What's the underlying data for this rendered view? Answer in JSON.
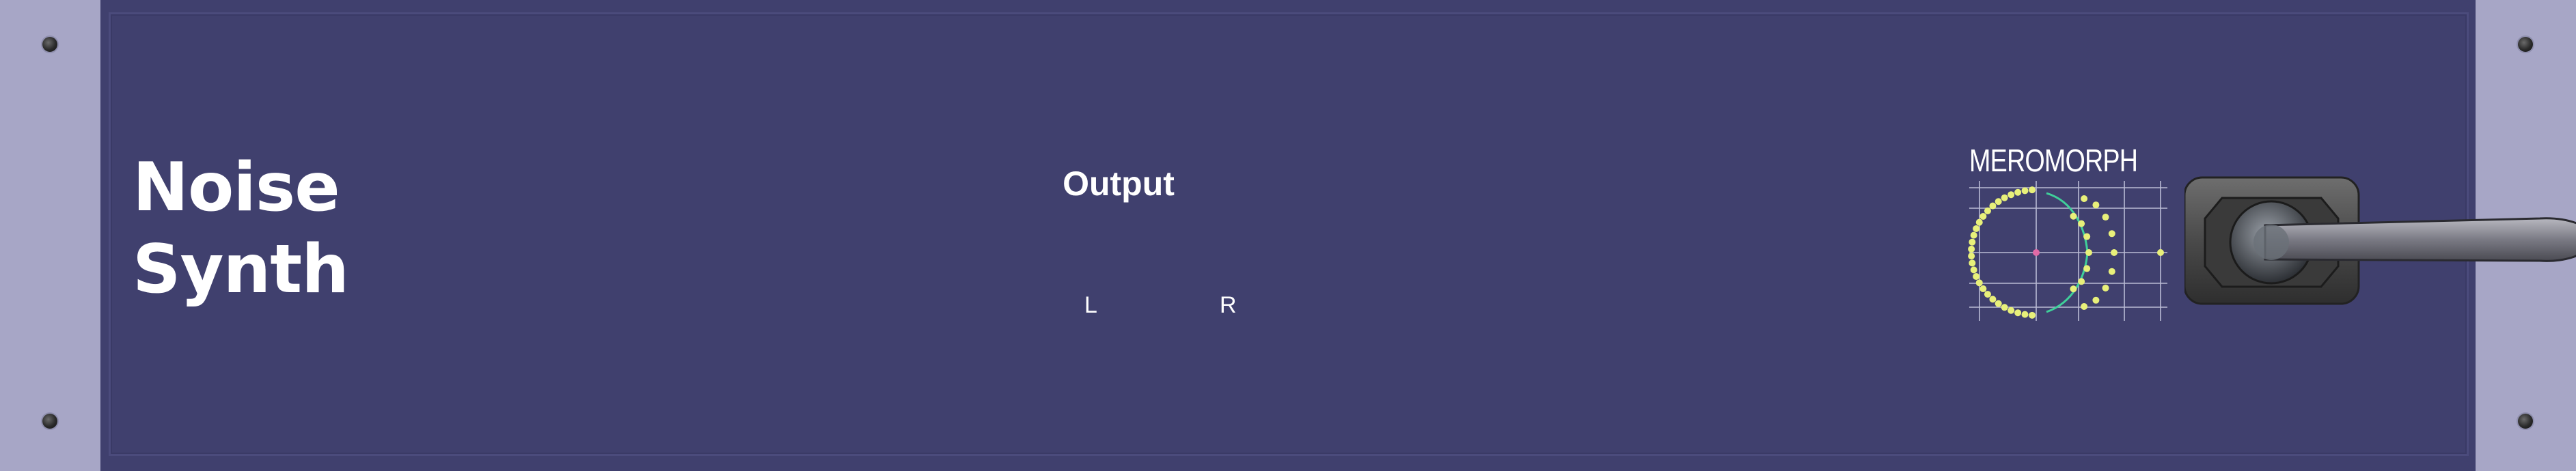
{
  "module": {
    "title_line1": "Noise",
    "title_line2": "Synth",
    "output_label": "Output",
    "left_channel": "L",
    "right_channel": "R",
    "brand": "MEROMORPH"
  },
  "colors": {
    "panel": "#40406e",
    "rack": "#a7a7c7",
    "text": "#ffffff",
    "logo_dots": "#e8f07a",
    "logo_curve": "#3fd09a"
  },
  "icons": [
    "screw-icon",
    "meromorph-logo-icon",
    "handle-icon"
  ]
}
